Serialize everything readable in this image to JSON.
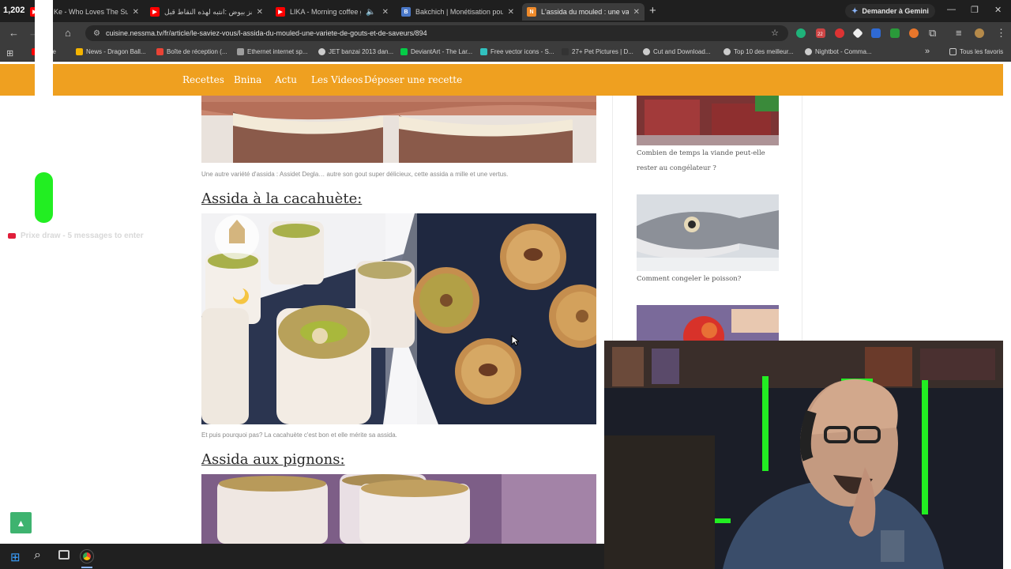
{
  "stream_counter": "1,202",
  "tabs": [
    {
      "title": "Jo Ke - Who Loves The Sun",
      "favicon_color": "#ff0000"
    },
    {
      "title": "معز بيوض :انتبه لهذه النقاط قبل",
      "favicon_color": "#ff0000"
    },
    {
      "title": "LIKA - Morning coffee group",
      "favicon_color": "#ff0000"
    },
    {
      "title": "Bakchich | Monétisation pour le",
      "favicon_color": "#ffffff"
    },
    {
      "title": "L'assida du mouled : une variét",
      "favicon_color": "#ef8a2a",
      "active": true
    }
  ],
  "gemini_label": "Demander à Gemini",
  "url": "cuisine.nessma.tv/fr/article/le-saviez-vous/l-assida-du-mouled-une-variete-de-gouts-et-de-saveurs/894",
  "extension_badge": "22",
  "bookmarks": [
    {
      "label": "Tube",
      "color": "#ff0000"
    },
    {
      "label": "News - Dragon Ball...",
      "color": "#f4b400"
    },
    {
      "label": "Boîte de réception (...",
      "color": "#ea4335"
    },
    {
      "label": "Ethernet internet sp...",
      "color": "#9e9e9e"
    },
    {
      "label": "JET banzai 2013 dan...",
      "color": "#cccccc"
    },
    {
      "label": "DeviantArt - The Lar...",
      "color": "#05cc47"
    },
    {
      "label": "Free vector icons - S...",
      "color": "#31c1bf"
    },
    {
      "label": "27+ Pet Pictures | D...",
      "color": "#333333"
    },
    {
      "label": "Cut and Download...",
      "color": "#cccccc"
    },
    {
      "label": "Top 10 des meilleur...",
      "color": "#cccccc"
    },
    {
      "label": "Nightbot - Comma...",
      "color": "#cccccc"
    }
  ],
  "bookmarks_overflow": "»",
  "all_bookmarks": "Tous les favoris",
  "site_nav": [
    "Recettes",
    "Bnina",
    "Actu",
    "Les Videos",
    "Déposer une recette"
  ],
  "article": {
    "caption1": "Une autre variété d'assida : Assidet Degla… autre son gout super délicieux, cette assida a mille et une vertus.",
    "heading1": "Assida à la cacahuète:",
    "caption2": "Et puis pourquoi pas? La cacahuète  c'est bon et elle  mérite sa assida.",
    "heading2": "Assida aux pignons:"
  },
  "sidebar": [
    {
      "caption": "Combien de temps la viande peut-elle rester au congélateur ?"
    },
    {
      "caption": "Comment congeler le poisson?"
    }
  ],
  "chat_overlay": "Prixe draw - 5 messages to enter",
  "scroll_top_label": "▲",
  "colors": {
    "site_orange": "#efa020",
    "browser_dark": "#1f1f1f",
    "toolbar": "#3c3c3c",
    "alert_green": "#22ee22",
    "scroll_top_green": "#3eb36f"
  }
}
